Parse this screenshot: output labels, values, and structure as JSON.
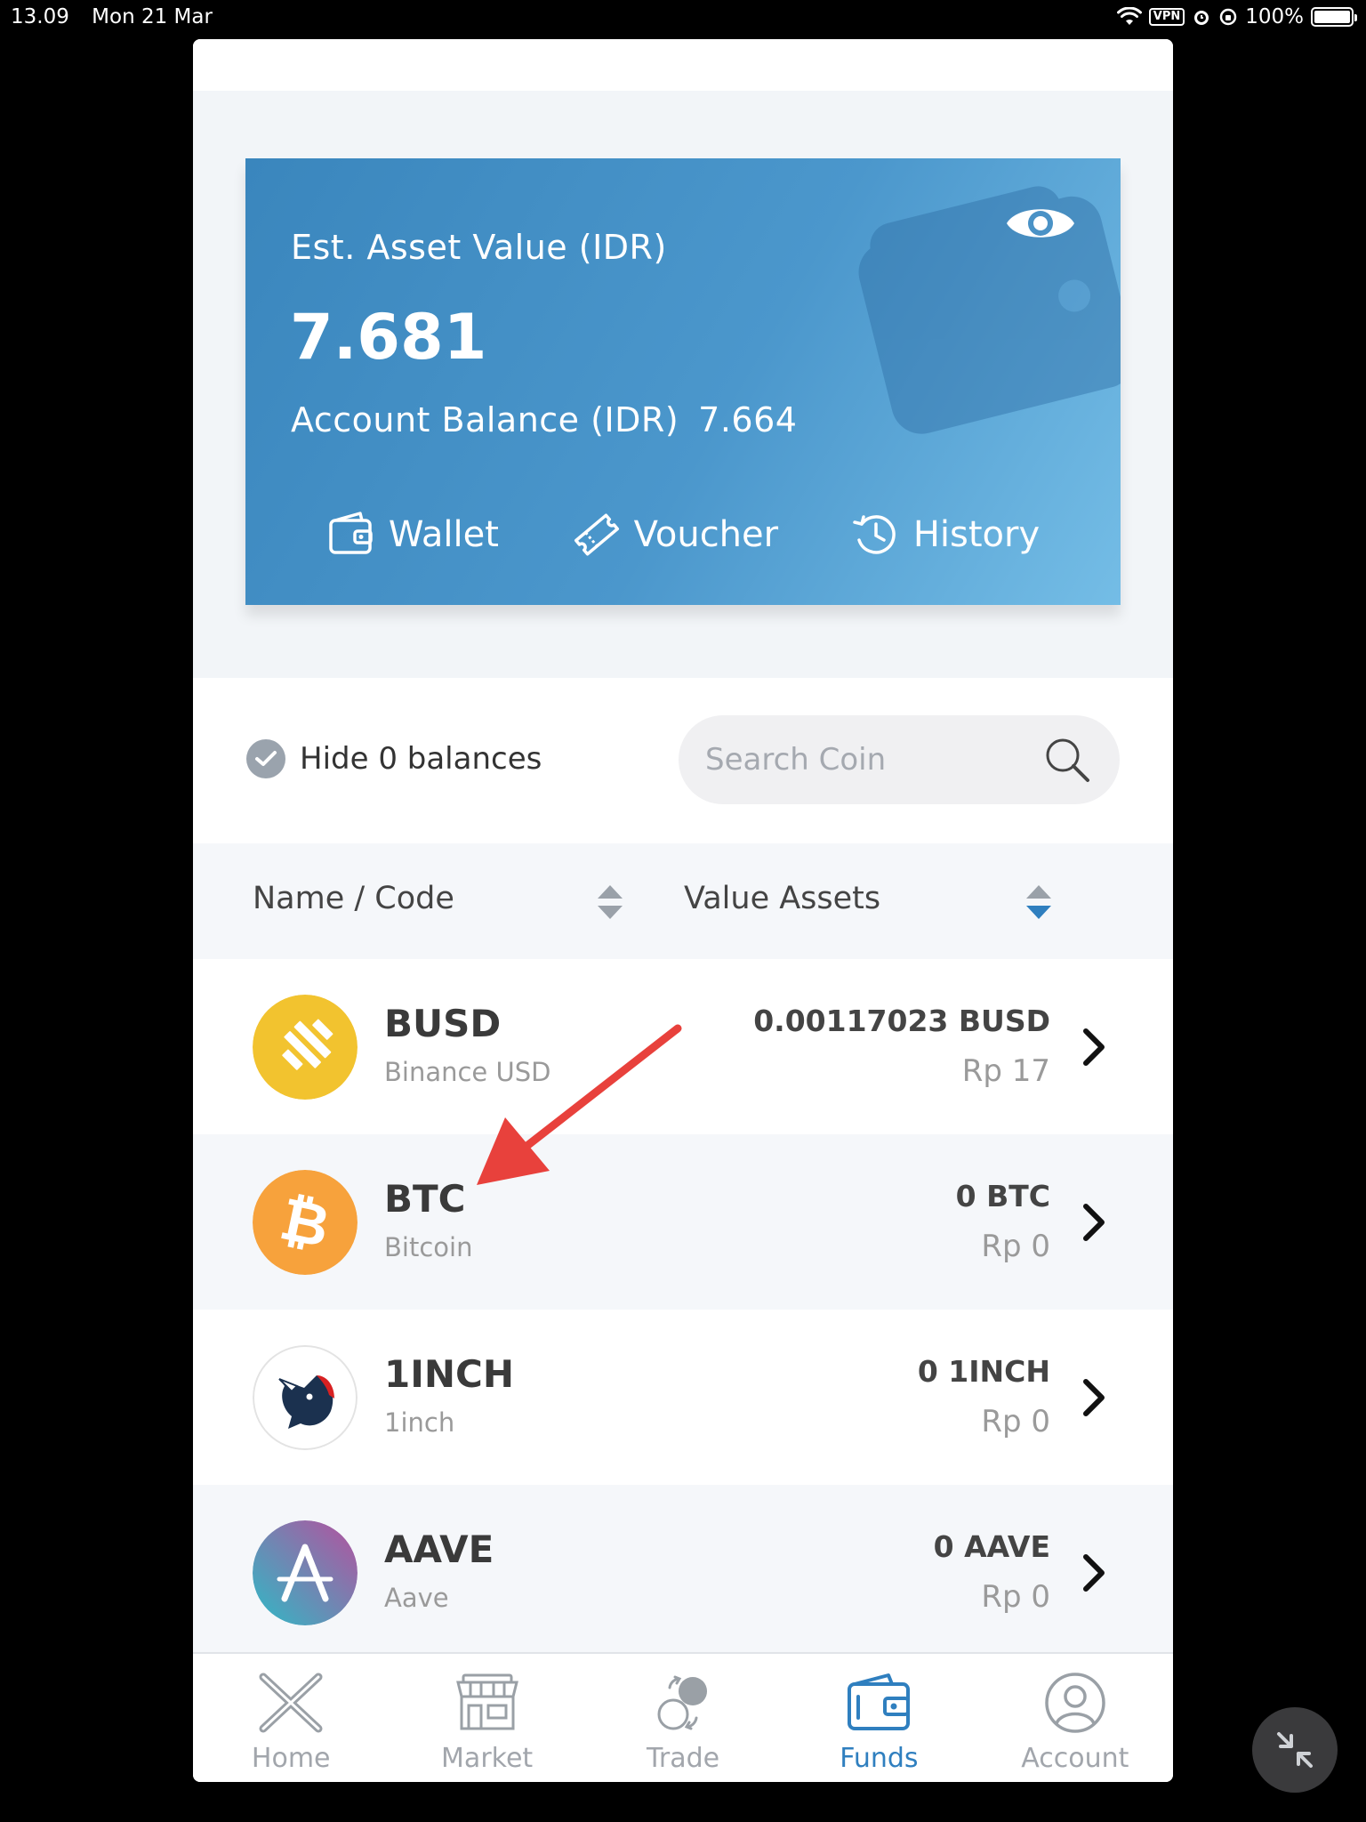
{
  "status_bar": {
    "time": "13.09",
    "date": "Mon 21 Mar",
    "vpn": "VPN",
    "battery": "100%"
  },
  "asset_card": {
    "est_label": "Est. Asset Value (IDR)",
    "est_value": "7.681",
    "balance_label": "Account Balance (IDR)",
    "balance_value": "7.664",
    "actions": [
      {
        "label": "Wallet",
        "icon": "wallet-icon"
      },
      {
        "label": "Voucher",
        "icon": "ticket-icon"
      },
      {
        "label": "History",
        "icon": "history-icon"
      }
    ]
  },
  "filter": {
    "hide_zero_label": "Hide 0 balances",
    "search_placeholder": "Search Coin"
  },
  "columns": {
    "name_code": "Name / Code",
    "value_assets": "Value Assets"
  },
  "coins": [
    {
      "code": "BUSD",
      "name": "Binance USD",
      "amount": "0.00117023 BUSD",
      "idr": "Rp 17",
      "color": "#F0B90B"
    },
    {
      "code": "BTC",
      "name": "Bitcoin",
      "amount": "0 BTC",
      "idr": "Rp 0",
      "color": "#F7931A"
    },
    {
      "code": "1INCH",
      "name": "1inch",
      "amount": "0 1INCH",
      "idr": "Rp 0",
      "color": "#1B314F"
    },
    {
      "code": "AAVE",
      "name": "Aave",
      "amount": "0 AAVE",
      "idr": "Rp 0",
      "color": "#B6509E"
    }
  ],
  "bottom_nav": [
    {
      "label": "Home",
      "icon": "home-icon"
    },
    {
      "label": "Market",
      "icon": "market-icon"
    },
    {
      "label": "Trade",
      "icon": "trade-icon"
    },
    {
      "label": "Funds",
      "icon": "funds-icon",
      "active": true
    },
    {
      "label": "Account",
      "icon": "account-icon"
    }
  ],
  "colors": {
    "accent": "#2F7FBF",
    "card_start": "#3A86BD",
    "card_end": "#74BDE6",
    "annotation_arrow": "#E8413C"
  }
}
